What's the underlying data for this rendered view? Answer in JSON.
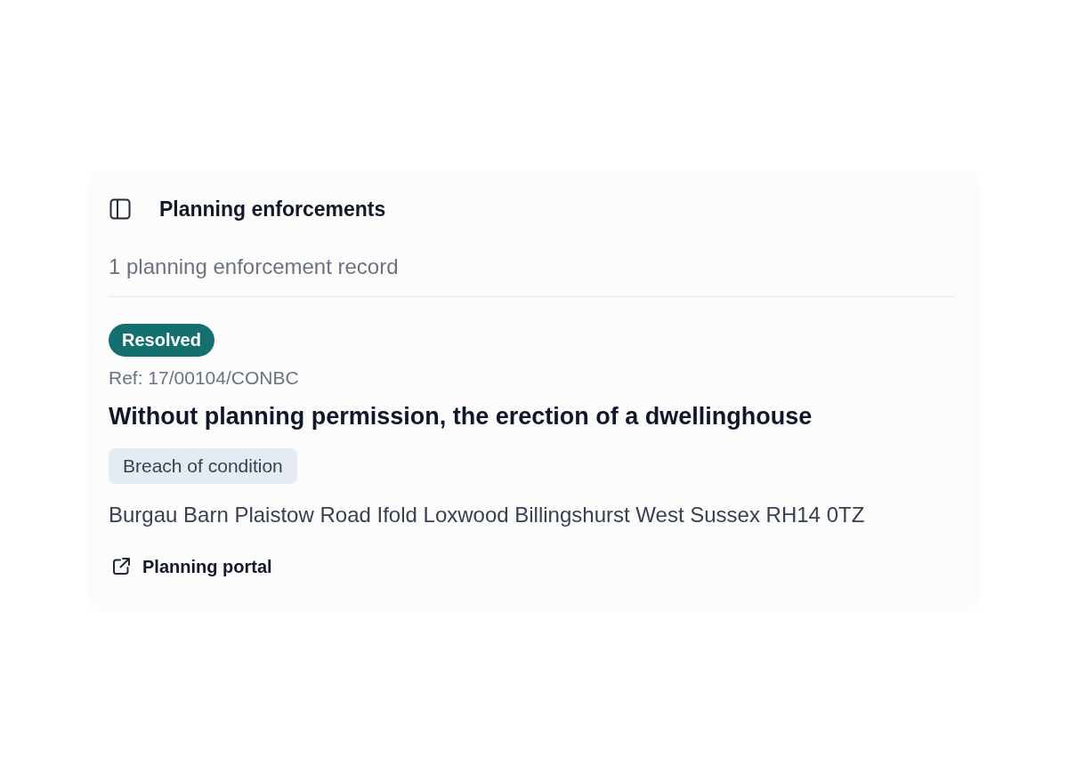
{
  "panel": {
    "title": "Planning enforcements",
    "summary": "1 planning enforcement record"
  },
  "records": [
    {
      "status": "Resolved",
      "reference": "Ref: 17/00104/CONBC",
      "description": "Without planning permission, the erection of a dwellinghouse",
      "category": "Breach of condition",
      "address": "Burgau Barn Plaistow Road Ifold Loxwood Billingshurst West Sussex RH14 0TZ",
      "link": "Planning portal"
    }
  ]
}
